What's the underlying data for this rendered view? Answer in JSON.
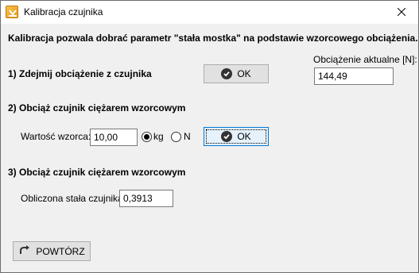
{
  "window": {
    "title": "Kalibracja czujnika",
    "close_symbol": "✕"
  },
  "intro": "Kalibracja pozwala dobrać parametr \"stała mostka\" na podstawie wzorcowego obciążenia.",
  "step1": {
    "heading": "1) Zdejmij obciążenie z czujnika",
    "ok_label": "OK",
    "current_load_label": "Obciążenie aktualne [N]:",
    "current_load_value": "144,49"
  },
  "step2": {
    "heading": "2) Obciąż czujnik ciężarem wzorcowym",
    "pattern_label": "Wartość wzorca:",
    "pattern_value": "10,00",
    "unit_kg": "kg",
    "unit_n": "N",
    "selected_unit": "kg",
    "ok_label": "OK"
  },
  "step3": {
    "heading": "3) Obciąż czujnik ciężarem wzorcowym",
    "constant_label": "Obliczona stała czujnika:",
    "constant_value": "0,3913"
  },
  "repeat_label": "POWTÓRZ",
  "icons": {
    "app": "calibration-app-icon",
    "ok": "check-circle-icon",
    "repeat": "redo-arrow-icon",
    "close": "close-icon"
  }
}
